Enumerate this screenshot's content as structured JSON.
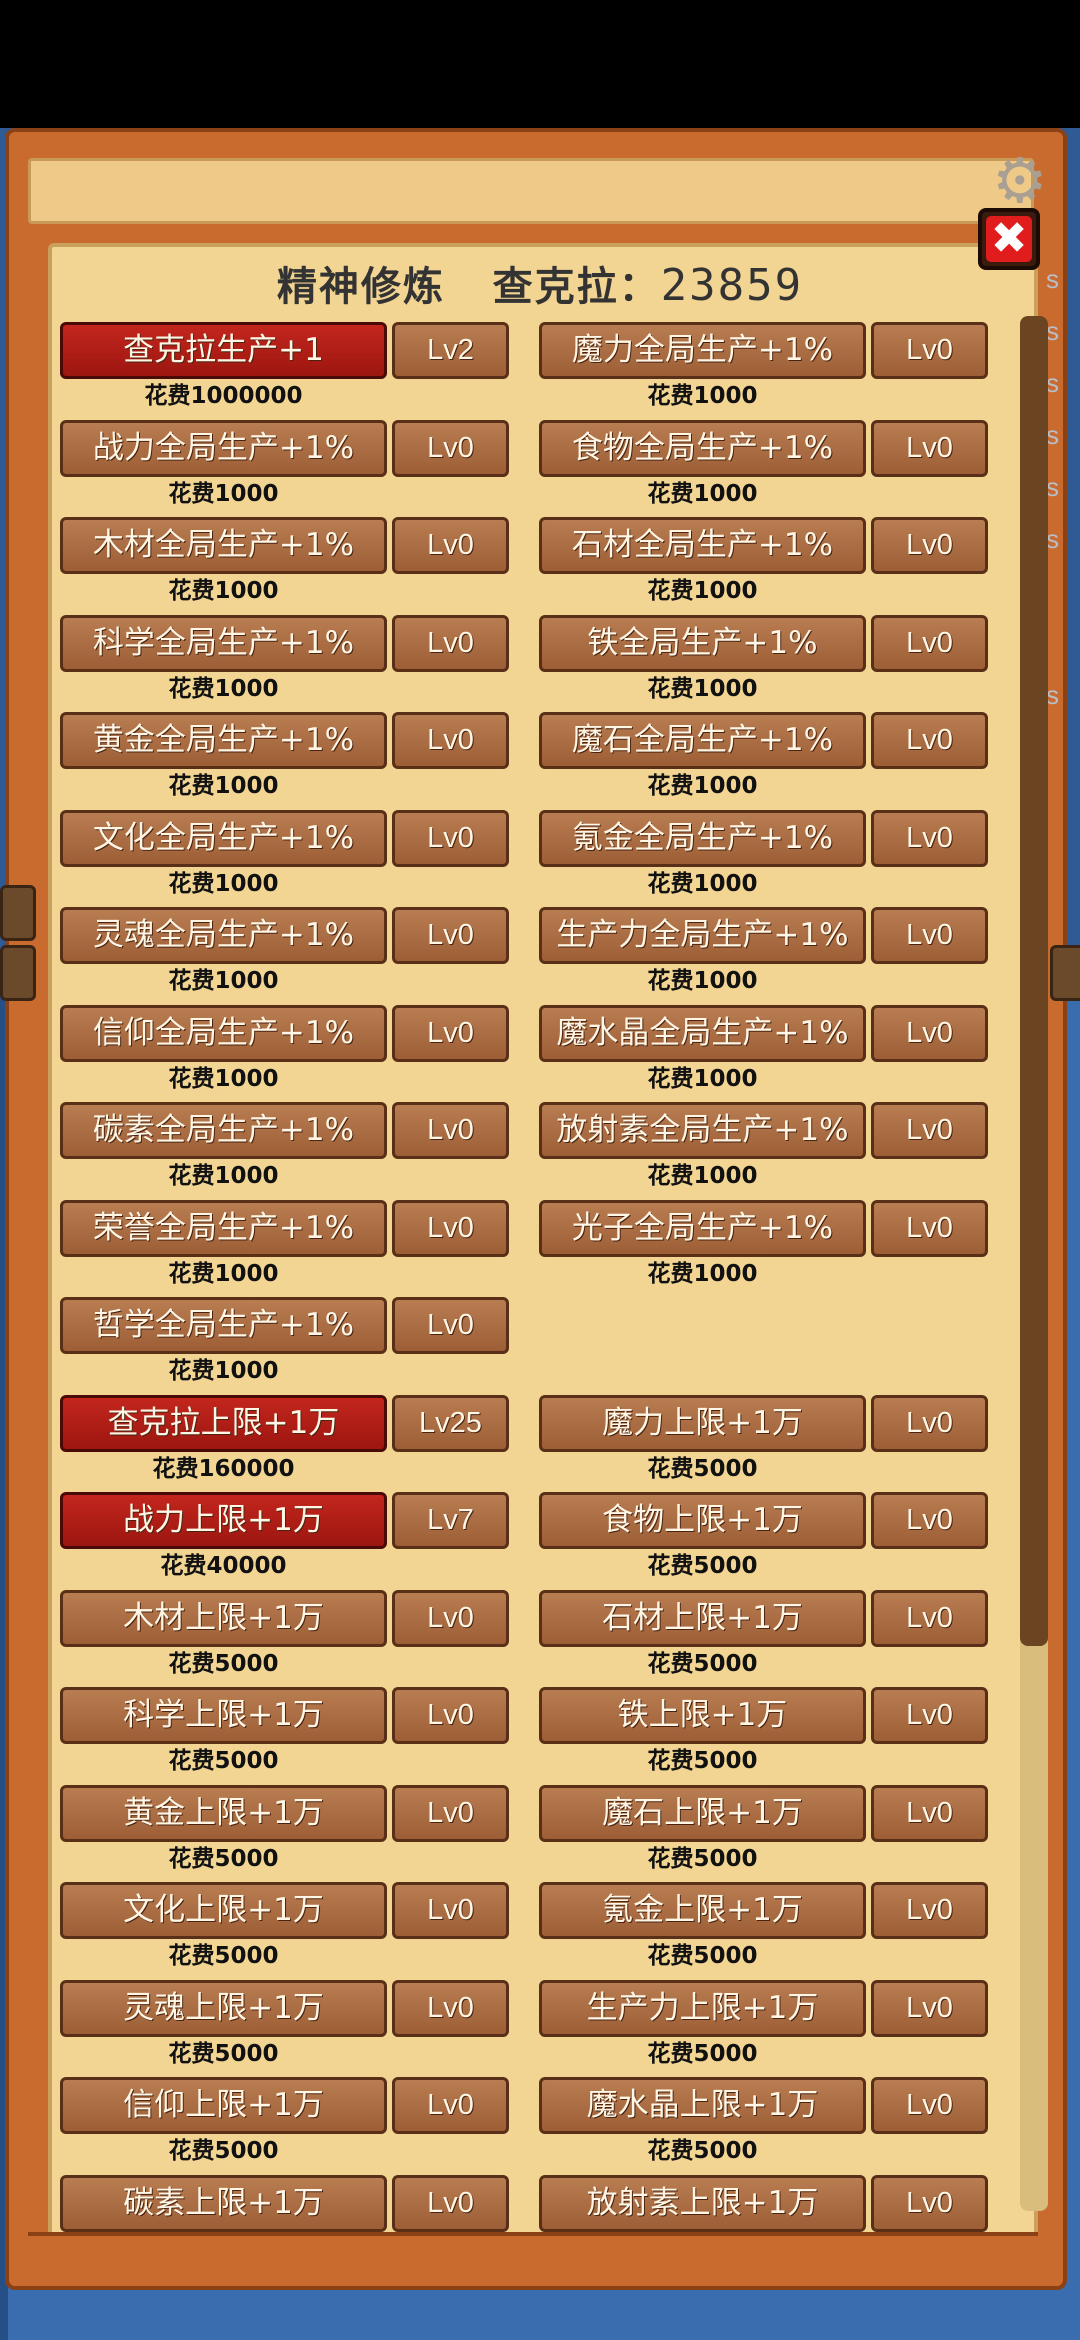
{
  "header": {
    "title": "精神修炼",
    "currency_label": "查克拉：",
    "currency_value": "23859"
  },
  "icons": {
    "close": "close-icon",
    "settings": "gear-icon"
  },
  "colors": {
    "button_brown": "#a86a40",
    "button_active_red": "#b51f17",
    "panel_parchment": "#f2d593",
    "frame_orange": "#c96a2e"
  },
  "edge_letters": [
    "s",
    "s",
    "s",
    "s",
    "s",
    "s",
    "s"
  ],
  "upgrades": [
    [
      {
        "label": "查克拉生产+1",
        "level": "Lv2",
        "cost": "花费1000000",
        "active": true
      },
      {
        "label": "魔力全局生产+1%",
        "level": "Lv0",
        "cost": "花费1000",
        "active": false
      }
    ],
    [
      {
        "label": "战力全局生产+1%",
        "level": "Lv0",
        "cost": "花费1000",
        "active": false
      },
      {
        "label": "食物全局生产+1%",
        "level": "Lv0",
        "cost": "花费1000",
        "active": false
      }
    ],
    [
      {
        "label": "木材全局生产+1%",
        "level": "Lv0",
        "cost": "花费1000",
        "active": false
      },
      {
        "label": "石材全局生产+1%",
        "level": "Lv0",
        "cost": "花费1000",
        "active": false
      }
    ],
    [
      {
        "label": "科学全局生产+1%",
        "level": "Lv0",
        "cost": "花费1000",
        "active": false
      },
      {
        "label": "铁全局生产+1%",
        "level": "Lv0",
        "cost": "花费1000",
        "active": false
      }
    ],
    [
      {
        "label": "黄金全局生产+1%",
        "level": "Lv0",
        "cost": "花费1000",
        "active": false
      },
      {
        "label": "魔石全局生产+1%",
        "level": "Lv0",
        "cost": "花费1000",
        "active": false
      }
    ],
    [
      {
        "label": "文化全局生产+1%",
        "level": "Lv0",
        "cost": "花费1000",
        "active": false
      },
      {
        "label": "氪金全局生产+1%",
        "level": "Lv0",
        "cost": "花费1000",
        "active": false
      }
    ],
    [
      {
        "label": "灵魂全局生产+1%",
        "level": "Lv0",
        "cost": "花费1000",
        "active": false
      },
      {
        "label": "生产力全局生产+1%",
        "level": "Lv0",
        "cost": "花费1000",
        "active": false
      }
    ],
    [
      {
        "label": "信仰全局生产+1%",
        "level": "Lv0",
        "cost": "花费1000",
        "active": false
      },
      {
        "label": "魔水晶全局生产+1%",
        "level": "Lv0",
        "cost": "花费1000",
        "active": false
      }
    ],
    [
      {
        "label": "碳素全局生产+1%",
        "level": "Lv0",
        "cost": "花费1000",
        "active": false
      },
      {
        "label": "放射素全局生产+1%",
        "level": "Lv0",
        "cost": "花费1000",
        "active": false
      }
    ],
    [
      {
        "label": "荣誉全局生产+1%",
        "level": "Lv0",
        "cost": "花费1000",
        "active": false
      },
      {
        "label": "光子全局生产+1%",
        "level": "Lv0",
        "cost": "花费1000",
        "active": false
      }
    ],
    [
      {
        "label": "哲学全局生产+1%",
        "level": "Lv0",
        "cost": "花费1000",
        "active": false
      }
    ],
    [
      {
        "label": "查克拉上限+1万",
        "level": "Lv25",
        "cost": "花费160000",
        "active": true
      },
      {
        "label": "魔力上限+1万",
        "level": "Lv0",
        "cost": "花费5000",
        "active": false
      }
    ],
    [
      {
        "label": "战力上限+1万",
        "level": "Lv7",
        "cost": "花费40000",
        "active": true
      },
      {
        "label": "食物上限+1万",
        "level": "Lv0",
        "cost": "花费5000",
        "active": false
      }
    ],
    [
      {
        "label": "木材上限+1万",
        "level": "Lv0",
        "cost": "花费5000",
        "active": false
      },
      {
        "label": "石材上限+1万",
        "level": "Lv0",
        "cost": "花费5000",
        "active": false
      }
    ],
    [
      {
        "label": "科学上限+1万",
        "level": "Lv0",
        "cost": "花费5000",
        "active": false
      },
      {
        "label": "铁上限+1万",
        "level": "Lv0",
        "cost": "花费5000",
        "active": false
      }
    ],
    [
      {
        "label": "黄金上限+1万",
        "level": "Lv0",
        "cost": "花费5000",
        "active": false
      },
      {
        "label": "魔石上限+1万",
        "level": "Lv0",
        "cost": "花费5000",
        "active": false
      }
    ],
    [
      {
        "label": "文化上限+1万",
        "level": "Lv0",
        "cost": "花费5000",
        "active": false
      },
      {
        "label": "氪金上限+1万",
        "level": "Lv0",
        "cost": "花费5000",
        "active": false
      }
    ],
    [
      {
        "label": "灵魂上限+1万",
        "level": "Lv0",
        "cost": "花费5000",
        "active": false
      },
      {
        "label": "生产力上限+1万",
        "level": "Lv0",
        "cost": "花费5000",
        "active": false
      }
    ],
    [
      {
        "label": "信仰上限+1万",
        "level": "Lv0",
        "cost": "花费5000",
        "active": false
      },
      {
        "label": "魔水晶上限+1万",
        "level": "Lv0",
        "cost": "花费5000",
        "active": false
      }
    ],
    [
      {
        "label": "碳素上限+1万",
        "level": "Lv0",
        "cost": "",
        "active": false
      },
      {
        "label": "放射素上限+1万",
        "level": "Lv0",
        "cost": "",
        "active": false
      }
    ]
  ]
}
